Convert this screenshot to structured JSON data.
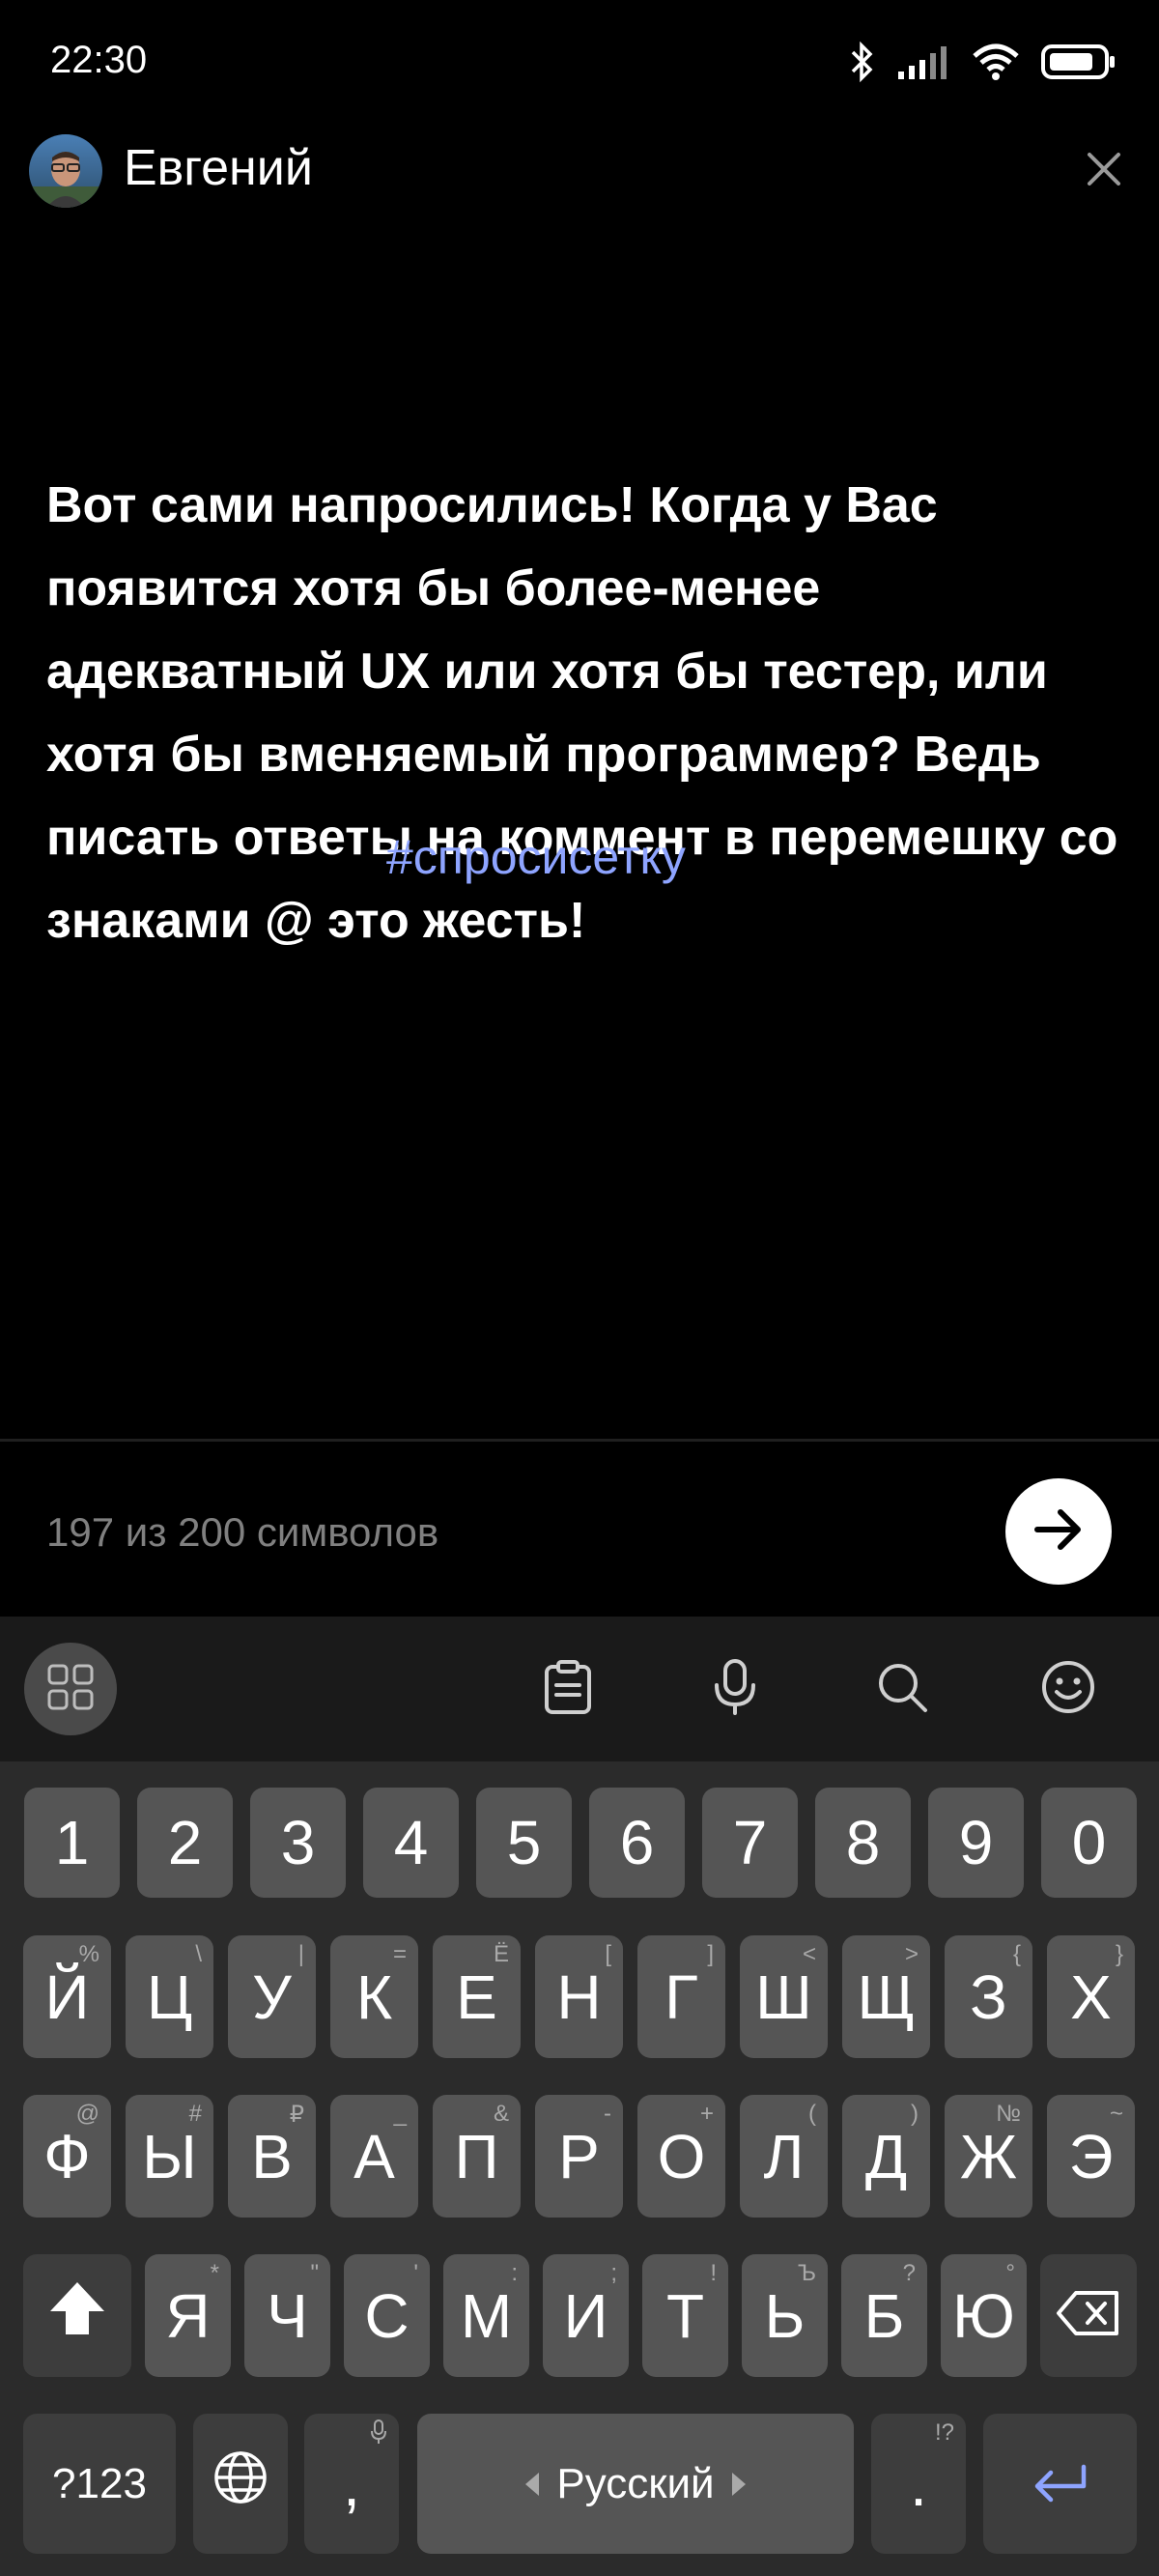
{
  "status": {
    "time": "22:30",
    "icons": [
      "bluetooth-icon",
      "signal-icon",
      "wifi-icon",
      "battery-icon"
    ]
  },
  "header": {
    "author_name": "Евгений"
  },
  "story": {
    "text": "Вот сами напросились! Когда у Вас появится хотя бы более-менее адекватный UX или хотя бы тестер, или хотя бы вменяемый программер? Ведь писать ответы на коммент в перемешку со знаками @ это жесть!",
    "hashtag": "#спросисетку",
    "hashtag_color": "#8ea4ff"
  },
  "composer": {
    "counter": "197 из 200 символов"
  },
  "keyboard": {
    "row_numbers": [
      "1",
      "2",
      "3",
      "4",
      "5",
      "6",
      "7",
      "8",
      "9",
      "0"
    ],
    "row1": [
      {
        "label": "Й",
        "hint": "%"
      },
      {
        "label": "Ц",
        "hint": "\\"
      },
      {
        "label": "У",
        "hint": "|"
      },
      {
        "label": "К",
        "hint": "="
      },
      {
        "label": "Е",
        "hint": "Ё"
      },
      {
        "label": "Н",
        "hint": "["
      },
      {
        "label": "Г",
        "hint": "]"
      },
      {
        "label": "Ш",
        "hint": "<"
      },
      {
        "label": "Щ",
        "hint": ">"
      },
      {
        "label": "З",
        "hint": "{"
      },
      {
        "label": "Х",
        "hint": "}"
      }
    ],
    "row2": [
      {
        "label": "Ф",
        "hint": "@"
      },
      {
        "label": "Ы",
        "hint": "#"
      },
      {
        "label": "В",
        "hint": "₽"
      },
      {
        "label": "А",
        "hint": "_"
      },
      {
        "label": "П",
        "hint": "&"
      },
      {
        "label": "Р",
        "hint": "-"
      },
      {
        "label": "О",
        "hint": "+"
      },
      {
        "label": "Л",
        "hint": "("
      },
      {
        "label": "Д",
        "hint": ")"
      },
      {
        "label": "Ж",
        "hint": "№"
      },
      {
        "label": "Э",
        "hint": "~"
      }
    ],
    "row3": [
      {
        "label": "Я",
        "hint": "*"
      },
      {
        "label": "Ч",
        "hint": "\""
      },
      {
        "label": "С",
        "hint": "'"
      },
      {
        "label": "М",
        "hint": ":"
      },
      {
        "label": "И",
        "hint": ";"
      },
      {
        "label": "Т",
        "hint": "!"
      },
      {
        "label": "Ь",
        "hint": "Ъ"
      },
      {
        "label": "Б",
        "hint": "?"
      },
      {
        "label": "Ю",
        "hint": "°"
      }
    ],
    "symbols_label": "?123",
    "comma": ",",
    "space_label": "Русский",
    "period": ".",
    "period_hint": "!?"
  }
}
